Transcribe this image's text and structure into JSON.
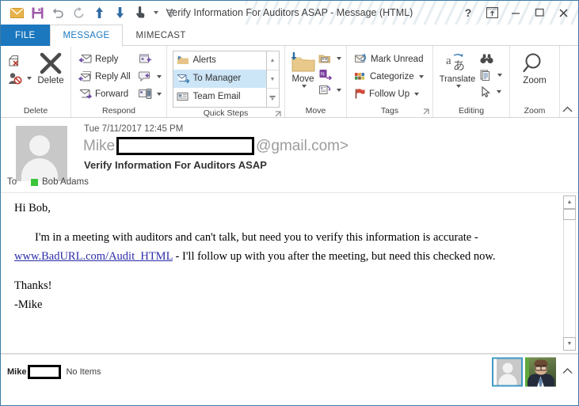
{
  "window": {
    "title": "Verify Information For Auditors ASAP - Message (HTML)",
    "quick_access": [
      {
        "name": "mail-icon",
        "label": "Mail"
      },
      {
        "name": "save-icon",
        "label": "Save"
      },
      {
        "name": "undo-icon",
        "label": "Undo"
      },
      {
        "name": "redo-icon",
        "label": "Redo"
      },
      {
        "name": "previous-item-icon",
        "label": "Previous Item"
      },
      {
        "name": "next-item-icon",
        "label": "Next Item"
      },
      {
        "name": "touch-mode-icon",
        "label": "Touch/Mouse Mode"
      },
      {
        "name": "customize-qat-icon",
        "label": "Customize Quick Access Toolbar"
      }
    ],
    "controls": {
      "help": "?",
      "ribbon_display": "ribbon-display-options",
      "minimize": "–",
      "maximize": "☐",
      "close": "✕"
    }
  },
  "tabs": [
    {
      "label": "FILE",
      "active": false,
      "style": "file"
    },
    {
      "label": "MESSAGE",
      "active": true,
      "style": "normal"
    },
    {
      "label": "MIMECAST",
      "active": false,
      "style": "normal"
    }
  ],
  "ribbon": {
    "groups": [
      {
        "name": "delete",
        "label": "Delete",
        "small_items": [
          {
            "label": "",
            "icon": "ignore-icon"
          },
          {
            "label": "",
            "icon": "junk-icon",
            "has_caret": true
          }
        ],
        "big_item": {
          "label": "Delete",
          "icon": "delete-x-icon"
        }
      },
      {
        "name": "respond",
        "label": "Respond",
        "items": [
          {
            "label": "Reply",
            "icon": "reply-icon"
          },
          {
            "label": "Reply All",
            "icon": "reply-all-icon"
          },
          {
            "label": "Forward",
            "icon": "forward-icon"
          }
        ],
        "extra_items": [
          {
            "label": "",
            "icon": "meeting-icon"
          },
          {
            "label": "",
            "icon": "im-icon",
            "has_caret": true
          },
          {
            "label": "",
            "icon": "more-respond-icon",
            "has_caret": true
          }
        ]
      },
      {
        "name": "quick-steps",
        "label": "Quick Steps",
        "items": [
          {
            "label": "Alerts",
            "icon": "alerts-folder-icon",
            "selected": false
          },
          {
            "label": "To Manager",
            "icon": "to-manager-icon",
            "selected": true
          },
          {
            "label": "Team Email",
            "icon": "team-email-icon",
            "selected": false
          }
        ],
        "has_dialog_launcher": true
      },
      {
        "name": "move",
        "label": "Move",
        "big_item": {
          "label": "Move",
          "icon": "move-folder-icon",
          "has_caret": true
        },
        "small_items": [
          {
            "label": "",
            "icon": "rules-icon",
            "has_caret": true
          },
          {
            "label": "",
            "icon": "onenote-icon"
          },
          {
            "label": "",
            "icon": "actions-icon",
            "has_caret": true
          }
        ]
      },
      {
        "name": "tags",
        "label": "Tags",
        "items": [
          {
            "label": "Mark Unread",
            "icon": "mark-unread-icon"
          },
          {
            "label": "Categorize",
            "icon": "categorize-icon",
            "has_caret": true
          },
          {
            "label": "Follow Up",
            "icon": "follow-up-flag-icon",
            "has_caret": true
          }
        ],
        "has_dialog_launcher": true
      },
      {
        "name": "editing",
        "label": "Editing",
        "big_item": {
          "label": "Translate",
          "icon": "translate-icon",
          "has_caret": true
        },
        "small_items": [
          {
            "label": "",
            "icon": "find-binoculars-icon"
          },
          {
            "label": "",
            "icon": "related-document-icon",
            "has_caret": true
          },
          {
            "label": "",
            "icon": "select-pointer-icon",
            "has_caret": true
          }
        ]
      },
      {
        "name": "zoom",
        "label": "Zoom",
        "big_item": {
          "label": "Zoom",
          "icon": "zoom-magnifier-icon"
        }
      }
    ],
    "collapse_label": "collapse-ribbon-icon"
  },
  "message": {
    "date": "Tue 7/11/2017 12:45 PM",
    "from_name": "Mike",
    "from_redacted": true,
    "from_domain": "@gmail.com>",
    "subject": "Verify Information For Auditors ASAP",
    "to_label": "To",
    "to_recipients": [
      {
        "name": "Bob Adams",
        "presence_color": "#3bc43b"
      }
    ],
    "avatar": "default-contact-avatar",
    "body": {
      "greeting": "Hi Bob,",
      "paragraph_before_link": "I'm in a meeting with auditors and can't talk, but need you to verify this information is accurate - ",
      "link_text": "www.BadURL.com/Audit_HTML",
      "paragraph_after_link": " - I'll follow up with you after the meeting, but need this checked now.",
      "closing": "Thanks!",
      "signature": "-Mike",
      "link_color": "#2c2ca8"
    }
  },
  "status_bar": {
    "name": "Mike",
    "redacted": true,
    "items_text": "No Items",
    "people_pane": {
      "selected_card": "default-contact-avatar",
      "photo_card": "contact-photo"
    },
    "collapse_label": "collapse-people-pane-icon"
  },
  "colors": {
    "accent": "#1b77be",
    "window_border": "#3d7ca5",
    "tab_active_text": "#1b77be",
    "file_tab_bg": "#1b77be",
    "selection_bg": "#cde6f7",
    "presence_online": "#3bc43b"
  }
}
